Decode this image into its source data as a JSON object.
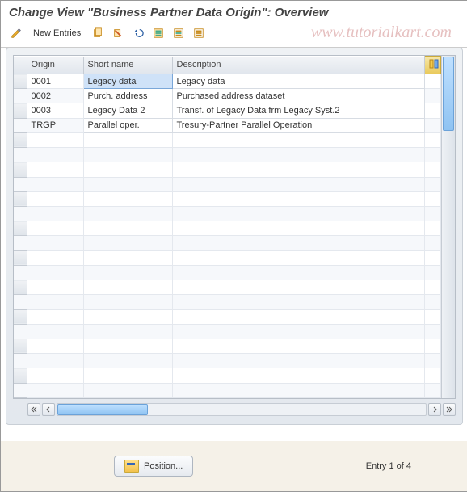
{
  "header": {
    "title": "Change View \"Business Partner Data Origin\": Overview"
  },
  "watermark": "www.tutorialkart.com",
  "toolbar": {
    "new_entries": "New Entries"
  },
  "table": {
    "columns": {
      "origin": "Origin",
      "short": "Short name",
      "desc": "Description"
    },
    "rows": [
      {
        "origin": "0001",
        "short": "Legacy data",
        "desc": "Legacy data"
      },
      {
        "origin": "0002",
        "short": "Purch. address",
        "desc": "Purchased address dataset"
      },
      {
        "origin": "0003",
        "short": "Legacy Data 2",
        "desc": "Transf. of Legacy Data frm Legacy Syst.2"
      },
      {
        "origin": "TRGP",
        "short": "Parallel oper.",
        "desc": "Tresury-Partner Parallel Operation"
      }
    ]
  },
  "footer": {
    "position": "Position...",
    "entry": "Entry 1 of 4"
  }
}
